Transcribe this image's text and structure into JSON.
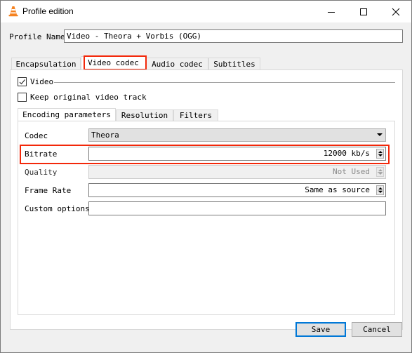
{
  "window": {
    "title": "Profile edition",
    "app_icon": "vlc-cone-icon",
    "controls": [
      "minimize-icon",
      "maximize-icon",
      "close-icon"
    ]
  },
  "profile": {
    "label": "Profile Name",
    "value": "Video - Theora + Vorbis (OGG)"
  },
  "tabs": [
    {
      "label": "Encapsulation",
      "active": false
    },
    {
      "label": "Video codec",
      "active": true,
      "highlighted": true
    },
    {
      "label": "Audio codec",
      "active": false
    },
    {
      "label": "Subtitles",
      "active": false
    }
  ],
  "video": {
    "enable_label": "Video",
    "enable_checked": true,
    "keep_original_label": "Keep original video track",
    "keep_original_checked": false
  },
  "subtabs": [
    {
      "label": "Encoding parameters",
      "active": true
    },
    {
      "label": "Resolution",
      "active": false
    },
    {
      "label": "Filters",
      "active": false
    }
  ],
  "params": {
    "codec": {
      "label": "Codec",
      "value": "Theora"
    },
    "bitrate": {
      "label": "Bitrate",
      "value": "12000 kb/s",
      "highlighted": true
    },
    "quality": {
      "label": "Quality",
      "value": "Not Used",
      "disabled": true
    },
    "framerate": {
      "label": "Frame Rate",
      "value": "Same as source"
    },
    "custom": {
      "label": "Custom options",
      "value": ""
    }
  },
  "buttons": {
    "save": "Save",
    "cancel": "Cancel"
  },
  "colors": {
    "highlight": "#f3280a",
    "default_button_border": "#0078d7"
  }
}
